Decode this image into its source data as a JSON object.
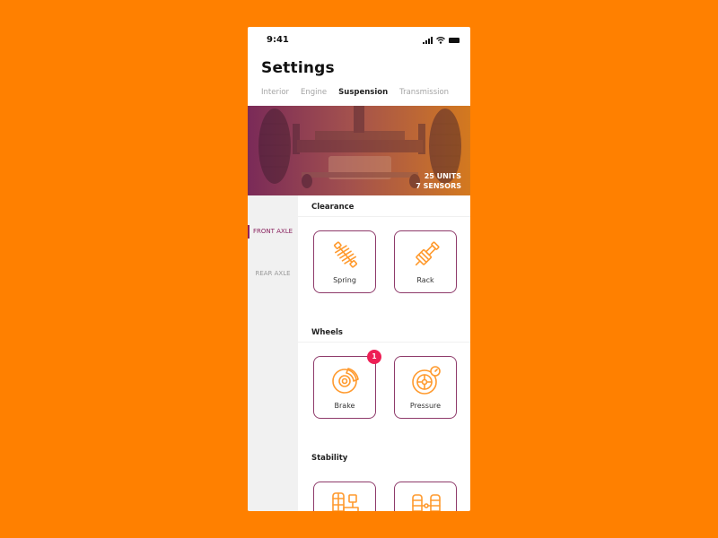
{
  "status_bar": {
    "time": "9:41"
  },
  "header": {
    "title": "Settings"
  },
  "tabs": [
    {
      "label": "Interior",
      "active": false
    },
    {
      "label": "Engine",
      "active": false
    },
    {
      "label": "Suspension",
      "active": true
    },
    {
      "label": "Transmission",
      "active": false
    }
  ],
  "hero": {
    "units": "25 UNITS",
    "sensors": "7 SENSORS"
  },
  "sidebar": {
    "items": [
      {
        "label": "FRONT AXLE",
        "active": true
      },
      {
        "label": "REAR AXLE",
        "active": false
      }
    ]
  },
  "sections": [
    {
      "title": "Clearance",
      "cards": [
        {
          "label": "Spring",
          "icon": "spring-icon"
        },
        {
          "label": "Rack",
          "icon": "rack-icon"
        }
      ]
    },
    {
      "title": "Wheels",
      "cards": [
        {
          "label": "Brake",
          "icon": "brake-disc-icon",
          "badge": "1"
        },
        {
          "label": "Pressure",
          "icon": "tire-pressure-icon"
        }
      ]
    },
    {
      "title": "Stability",
      "cards": [
        {
          "label": "",
          "icon": "stabilizer-icon"
        },
        {
          "label": "",
          "icon": "axle-link-icon"
        }
      ]
    }
  ],
  "colors": {
    "background": "#ff8000",
    "accent": "#8a2460",
    "icon": "#ff9a2e",
    "badge": "#ee1f55"
  }
}
